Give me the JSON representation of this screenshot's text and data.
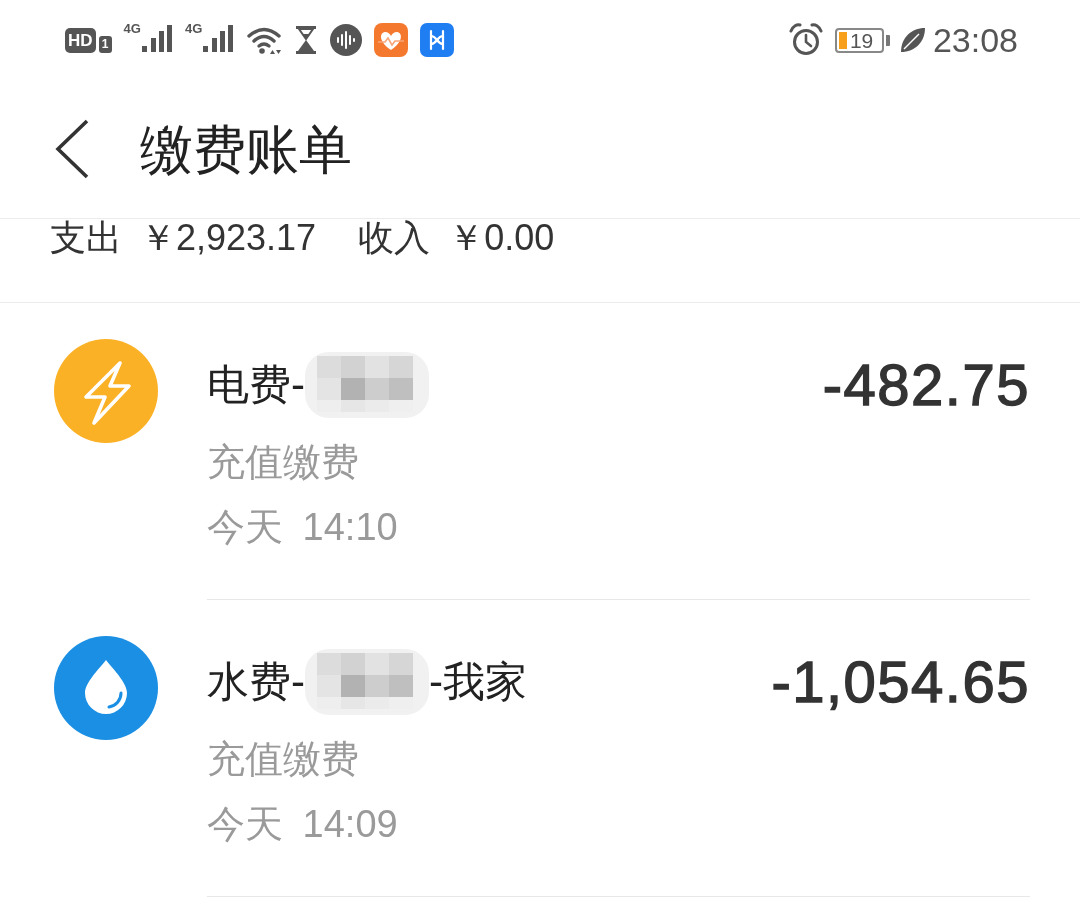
{
  "status_bar": {
    "left": [
      {
        "kind": "hd",
        "label": "HD",
        "sim": "1"
      },
      {
        "kind": "cell",
        "label": "4G"
      },
      {
        "kind": "cell",
        "label": "4G"
      },
      {
        "kind": "wifi"
      },
      {
        "kind": "hourglass"
      },
      {
        "kind": "voice"
      },
      {
        "kind": "health-app"
      },
      {
        "kind": "app"
      }
    ],
    "right": [
      {
        "kind": "alarm"
      },
      {
        "kind": "battery",
        "label": "19"
      },
      {
        "kind": "leaf"
      }
    ],
    "time": "23:08"
  },
  "header": {
    "title": "缴费账单"
  },
  "summary": [
    {
      "label": "支出",
      "amount": "￥2,923.17"
    },
    {
      "label": "收入",
      "amount": "￥0.00"
    }
  ],
  "bills": [
    {
      "kind": "electricity",
      "title": [
        {
          "kind": "text",
          "text": "电费-"
        },
        {
          "kind": "redacted"
        }
      ],
      "amount": "-482.75",
      "category": "充值缴费",
      "time": "今天 14:10"
    },
    {
      "kind": "water",
      "title": [
        {
          "kind": "text",
          "text": "水费-"
        },
        {
          "kind": "redacted"
        },
        {
          "kind": "text",
          "text": "-我家"
        }
      ],
      "amount": "-1,054.65",
      "category": "充值缴费",
      "time": "今天 14:09"
    }
  ]
}
